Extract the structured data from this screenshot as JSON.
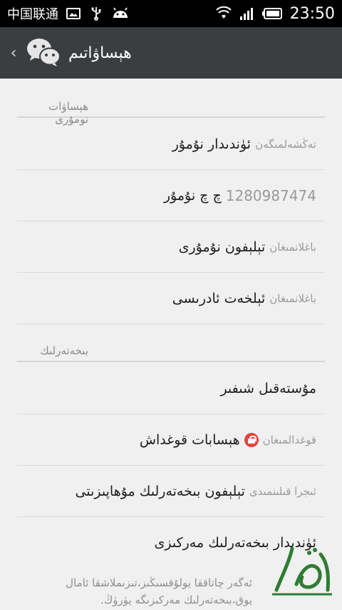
{
  "status_bar": {
    "carrier": "中国联通",
    "time": "23:50",
    "icons": [
      "image-icon",
      "usb-icon",
      "android-icon",
      "wifi-icon",
      "signal-icon",
      "battery-icon"
    ]
  },
  "title_bar": {
    "back_glyph": "‹",
    "title": "ھېساۋاتىم"
  },
  "sections": [
    {
      "header": "ھېساۋات نومۇرى",
      "rows": [
        {
          "hint": "تەڭشەلمىگەن",
          "main": "ئۈندىدار نۇمۇر"
        },
        {
          "hint": "1280987474",
          "main": "چ چ نۇمۇر"
        },
        {
          "hint": "باغلانمىغان",
          "main": "تېلېفون نۇمۇرى"
        },
        {
          "hint": "باغلانمىغان",
          "main": "ئېلخەت ئادرىسى"
        }
      ]
    },
    {
      "header": "بىخەتەرلىك",
      "rows": [
        {
          "hint": "",
          "main": "مۇستەقىل شىفىر"
        },
        {
          "hint": "قوغدالمىغان",
          "main": "ھېسابات قوغداش"
        },
        {
          "hint": "ئىجرا قىلىنمىدى",
          "main": "تېلېفون بىخەتەرلىك مۇھاپىزىتى"
        },
        {
          "hint": "",
          "main": "ئۈندىدار بىخەتەرلىك مەركىزى"
        }
      ]
    }
  ],
  "footer_note": "ئەگەر چاتاققا يولۇقسىڭىز،تىزىملاشقا ئامال يوق،بىخەتەرلىك مەركىزىگە يۈرۈڭ.",
  "colors": {
    "title_bar": "#3a3e41",
    "background": "#f0f0f0",
    "accent_green": "#2e7d32",
    "badge_red": "#e64340"
  }
}
